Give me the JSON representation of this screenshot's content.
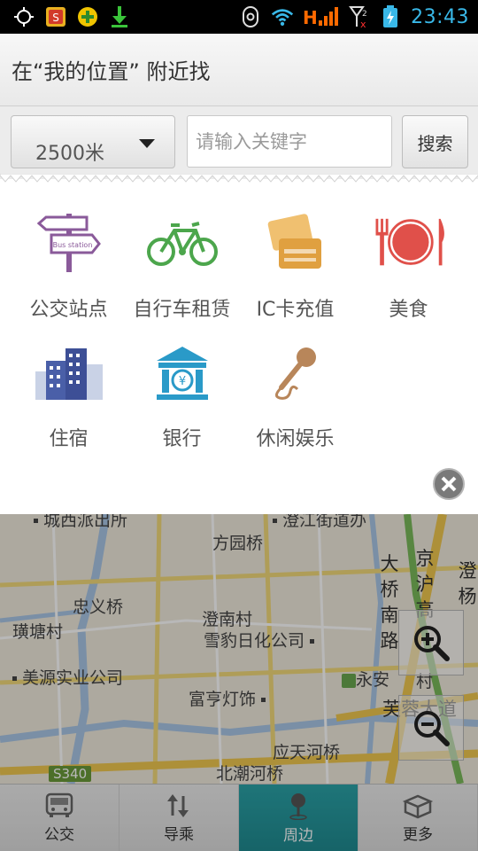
{
  "title_bar": {
    "title": "在“我的位置” 附近找"
  },
  "search": {
    "range_value": "2500米",
    "keyword_placeholder": "请输入关键字",
    "search_label": "搜索"
  },
  "status_bar": {
    "time": "23:43"
  },
  "categories": [
    {
      "label": "公交站点",
      "icon": "bus-station-sign-icon",
      "icon_text": "Bus station"
    },
    {
      "label": "自行车租赁",
      "icon": "bicycle-icon"
    },
    {
      "label": "IC卡充值",
      "icon": "ic-card-icon"
    },
    {
      "label": "美食",
      "icon": "dining-plate-icon"
    },
    {
      "label": "住宿",
      "icon": "hotel-building-icon"
    },
    {
      "label": "银行",
      "icon": "bank-icon"
    },
    {
      "label": "休闲娱乐",
      "icon": "microphone-icon"
    }
  ],
  "map": {
    "labels": [
      "城西派出所",
      "澄江街道办",
      "方园桥",
      "忠义桥",
      "璜塘村",
      "澄南村",
      "雪豹日化公司",
      "美源实业公司",
      "富亨灯饰",
      "永安",
      "村",
      "应天河桥",
      "北潮河桥",
      "S340"
    ],
    "vertical_roads": [
      "大桥南路",
      "京沪高",
      "澄杨"
    ],
    "road_east": "芙蓉大道"
  },
  "nav": {
    "items": [
      {
        "label": "公交",
        "icon": "bus-icon"
      },
      {
        "label": "导乘",
        "icon": "route-arrows-icon"
      },
      {
        "label": "周边",
        "icon": "location-pin-icon"
      },
      {
        "label": "更多",
        "icon": "box-icon"
      }
    ]
  },
  "colors": {
    "nav_active": "#2ba3a8",
    "time": "#39b8e8",
    "signal": "#ff6a00"
  }
}
